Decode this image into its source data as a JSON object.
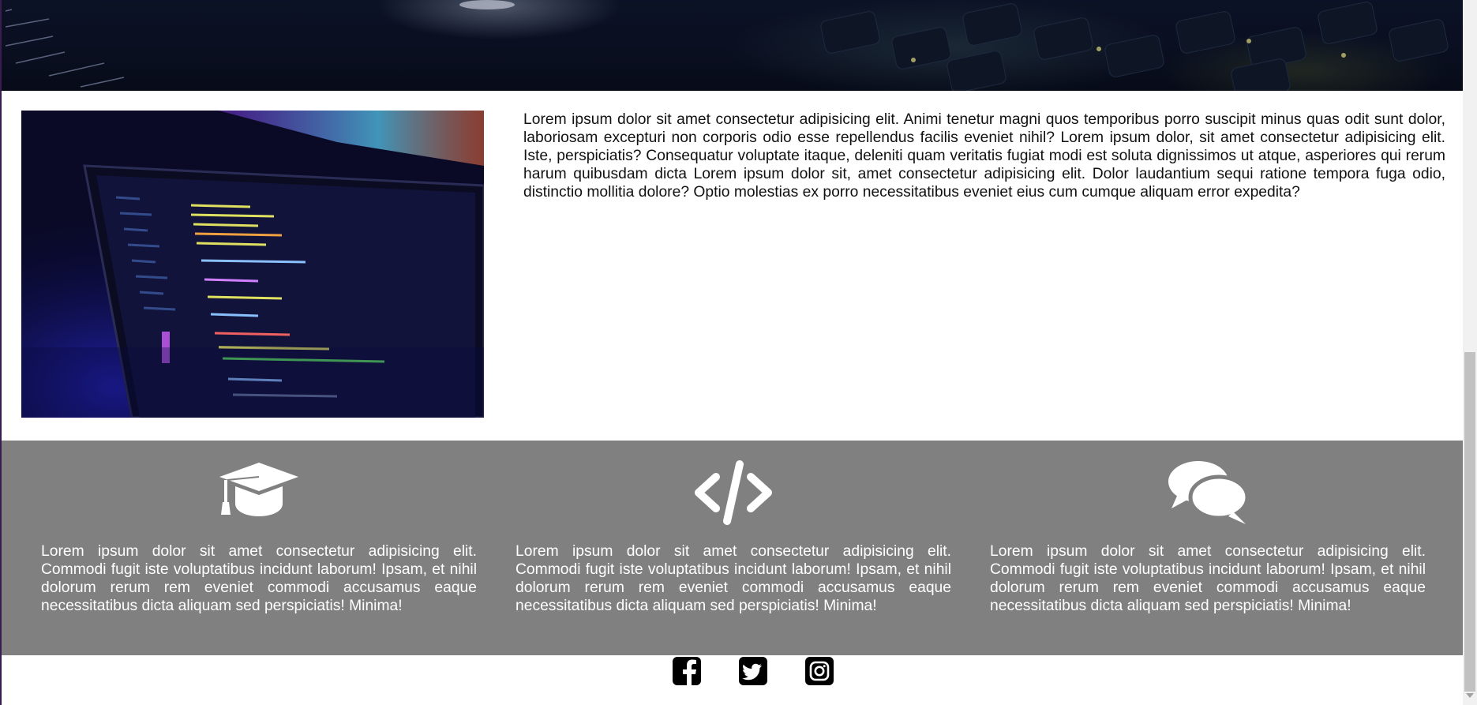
{
  "intro": {
    "paragraph": "Lorem ipsum dolor sit amet consectetur adipisicing elit. Animi tenetur magni quos temporibus porro suscipit minus quas odit sunt dolor, laboriosam excepturi non corporis odio esse repellendus facilis eveniet nihil? Lorem ipsum dolor, sit amet consectetur adipisicing elit. Iste, perspiciatis? Consequatur voluptate itaque, deleniti quam veritatis fugiat modi est soluta dignissimos ut atque, asperiores qui rerum harum quibusdam dicta Lorem ipsum dolor sit, amet consectetur adipisicing elit. Dolor laudantium sequi ratione tempora fuga odio, distinctio mollitia dolore? Optio molestias ex porro necessitatibus eveniet eius cum cumque aliquam error expedita?"
  },
  "features": [
    {
      "icon": "graduation-cap-icon",
      "text": "Lorem ipsum dolor sit amet consectetur adipisicing elit. Commodi fugit iste voluptatibus incidunt laborum! Ipsam, et nihil dolorum rerum rem eveniet commodi accusamus eaque necessitatibus dicta aliquam sed perspiciatis! Minima!"
    },
    {
      "icon": "code-icon",
      "text": "Lorem ipsum dolor sit amet consectetur adipisicing elit. Commodi fugit iste voluptatibus incidunt laborum! Ipsam, et nihil dolorum rerum rem eveniet commodi accusamus eaque necessitatibus dicta aliquam sed perspiciatis! Minima!"
    },
    {
      "icon": "comments-icon",
      "text": "Lorem ipsum dolor sit amet consectetur adipisicing elit. Commodi fugit iste voluptatibus incidunt laborum! Ipsam, et nihil dolorum rerum rem eveniet commodi accusamus eaque necessitatibus dicta aliquam sed perspiciatis! Minima!"
    }
  ],
  "social": [
    "facebook-icon",
    "twitter-icon",
    "instagram-icon"
  ],
  "colors": {
    "features_bg": "#808080",
    "feature_text": "#ffffff",
    "icon": "#ffffff",
    "social_icon": "#000000"
  }
}
